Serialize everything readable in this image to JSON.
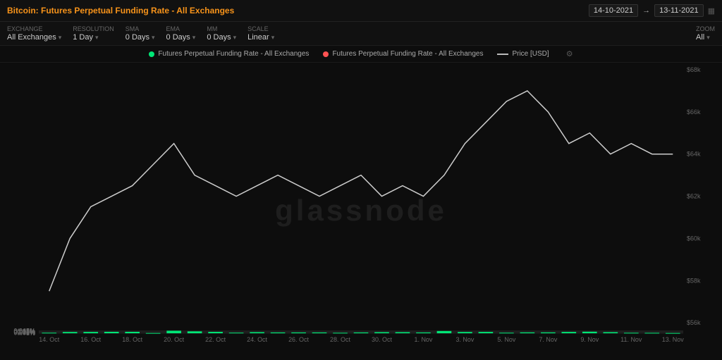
{
  "header": {
    "title_prefix": "Bitcoin:",
    "title_main": "Futures Perpetual Funding Rate - All Exchanges",
    "date_start": "14-10-2021",
    "date_end": "13-11-2021"
  },
  "controls": {
    "exchange_label": "Exchange",
    "exchange_value": "All Exchanges",
    "resolution_label": "Resolution",
    "resolution_value": "1 Day",
    "sma_label": "SMA",
    "sma_value": "0 Days",
    "ema_label": "EMA",
    "ema_value": "0 Days",
    "mm_label": "MM",
    "mm_value": "0 Days",
    "scale_label": "Scale",
    "scale_value": "Linear",
    "zoom_label": "Zoom",
    "zoom_value": "All"
  },
  "legend": {
    "items": [
      {
        "label": "Futures Perpetual Funding Rate - All Exchanges",
        "color": "#00e676",
        "type": "dot"
      },
      {
        "label": "Futures Perpetual Funding Rate - All Exchanges",
        "color": "#ff5252",
        "type": "dot"
      },
      {
        "label": "Price [USD]",
        "color": "#bbb",
        "type": "line"
      }
    ]
  },
  "watermark": "glassnode",
  "yaxis_left": [
    "0.045%",
    "0.04%",
    "0.035%",
    "0.03%",
    "0.025%",
    "0.02%",
    "0.015%",
    "0.01%",
    "0.005%",
    "0%"
  ],
  "yaxis_right": [
    "$68k",
    "$66k",
    "$64k",
    "$62k",
    "$60k",
    "$58k",
    "$56k"
  ],
  "xaxis": [
    "14. Oct",
    "16. Oct",
    "18. Oct",
    "20. Oct",
    "22. Oct",
    "24. Oct",
    "26. Oct",
    "28. Oct",
    "30. Oct",
    "1. Nov",
    "3. Nov",
    "5. Nov",
    "7. Nov",
    "9. Nov",
    "11. Nov",
    "13. Nov"
  ],
  "bars": [
    {
      "date": "14. Oct",
      "value": 0.01
    },
    {
      "date": "15. Oct",
      "value": 0.023
    },
    {
      "date": "16. Oct",
      "value": 0.024
    },
    {
      "date": "17. Oct",
      "value": 0.026
    },
    {
      "date": "18. Oct",
      "value": 0.026
    },
    {
      "date": "19. Oct",
      "value": 0.005
    },
    {
      "date": "20. Oct",
      "value": 0.045
    },
    {
      "date": "21. Oct",
      "value": 0.034
    },
    {
      "date": "22. Oct",
      "value": 0.025
    },
    {
      "date": "23. Oct",
      "value": 0.011
    },
    {
      "date": "24. Oct",
      "value": 0.02
    },
    {
      "date": "25. Oct",
      "value": 0.015
    },
    {
      "date": "26. Oct",
      "value": 0.015
    },
    {
      "date": "27. Oct",
      "value": 0.015
    },
    {
      "date": "28. Oct",
      "value": 0.009
    },
    {
      "date": "29. Oct",
      "value": 0.015
    },
    {
      "date": "30. Oct",
      "value": 0.02
    },
    {
      "date": "31. Oct",
      "value": 0.02
    },
    {
      "date": "1. Nov",
      "value": 0.015
    },
    {
      "date": "2. Nov",
      "value": 0.04
    },
    {
      "date": "3. Nov",
      "value": 0.023
    },
    {
      "date": "4. Nov",
      "value": 0.024
    },
    {
      "date": "5. Nov",
      "value": 0.01
    },
    {
      "date": "6. Nov",
      "value": 0.016
    },
    {
      "date": "7. Nov",
      "value": 0.016
    },
    {
      "date": "8. Nov",
      "value": 0.024
    },
    {
      "date": "9. Nov",
      "value": 0.028
    },
    {
      "date": "10. Nov",
      "value": 0.02
    },
    {
      "date": "11. Nov",
      "value": 0.009
    },
    {
      "date": "12. Nov",
      "value": 0.008
    },
    {
      "date": "13. Nov",
      "value": 0.005
    }
  ],
  "price_line": [
    {
      "date": "14. Oct",
      "price": 57500
    },
    {
      "date": "15. Oct",
      "price": 60000
    },
    {
      "date": "16. Oct",
      "price": 61500
    },
    {
      "date": "17. Oct",
      "price": 62000
    },
    {
      "date": "18. Oct",
      "price": 62500
    },
    {
      "date": "19. Oct",
      "price": 63500
    },
    {
      "date": "20. Oct",
      "price": 64500
    },
    {
      "date": "21. Oct",
      "price": 63000
    },
    {
      "date": "22. Oct",
      "price": 62500
    },
    {
      "date": "23. Oct",
      "price": 62000
    },
    {
      "date": "24. Oct",
      "price": 62500
    },
    {
      "date": "25. Oct",
      "price": 63000
    },
    {
      "date": "26. Oct",
      "price": 62500
    },
    {
      "date": "27. Oct",
      "price": 62000
    },
    {
      "date": "28. Oct",
      "price": 62500
    },
    {
      "date": "29. Oct",
      "price": 63000
    },
    {
      "date": "30. Oct",
      "price": 62000
    },
    {
      "date": "31. Oct",
      "price": 62500
    },
    {
      "date": "1. Nov",
      "price": 62000
    },
    {
      "date": "2. Nov",
      "price": 63000
    },
    {
      "date": "3. Nov",
      "price": 64500
    },
    {
      "date": "4. Nov",
      "price": 65500
    },
    {
      "date": "5. Nov",
      "price": 66500
    },
    {
      "date": "6. Nov",
      "price": 67000
    },
    {
      "date": "7. Nov",
      "price": 66000
    },
    {
      "date": "8. Nov",
      "price": 64500
    },
    {
      "date": "9. Nov",
      "price": 65000
    },
    {
      "date": "10. Nov",
      "price": 64000
    },
    {
      "date": "11. Nov",
      "price": 64500
    },
    {
      "date": "12. Nov",
      "price": 64000
    },
    {
      "date": "13. Nov",
      "price": 64000
    }
  ]
}
